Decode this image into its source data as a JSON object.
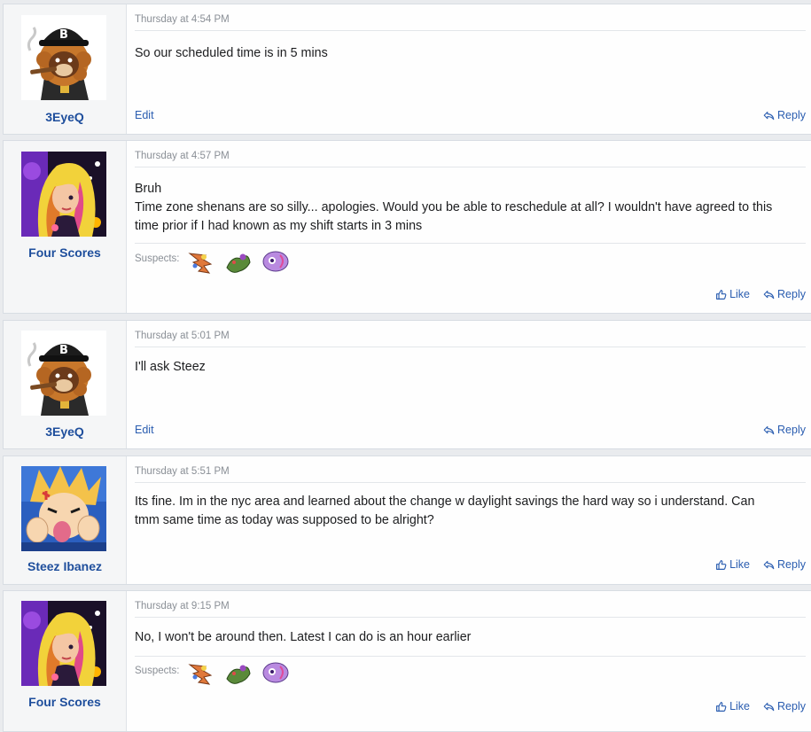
{
  "posts": [
    {
      "username": "3EyeQ",
      "date": "Thursday at 4:54 PM",
      "lines": [
        "So our scheduled time is in 5 mins"
      ],
      "edit_label": "Edit",
      "reply_label": "Reply"
    },
    {
      "username": "Four Scores",
      "date": "Thursday at 4:57 PM",
      "lines": [
        "Bruh",
        "Time zone shenans are so silly... apologies. Would you be able to reschedule at all? I wouldn't have agreed to this",
        "time prior if I had known as my shift starts in 3 mins"
      ],
      "suspects_label": "Suspects:",
      "like_label": "Like",
      "reply_label": "Reply"
    },
    {
      "username": "3EyeQ",
      "date": "Thursday at 5:01 PM",
      "lines": [
        "I'll ask Steez"
      ],
      "edit_label": "Edit",
      "reply_label": "Reply"
    },
    {
      "username": "Steez Ibanez",
      "date": "Thursday at 5:51 PM",
      "lines": [
        "Its fine. Im in the nyc area and learned about the change w daylight savings the hard way so i understand. Can",
        "tmm same time as today was supposed to be alright?"
      ],
      "like_label": "Like",
      "reply_label": "Reply"
    },
    {
      "username": "Four Scores",
      "date": "Thursday at 9:15 PM",
      "lines": [
        "No, I won't be around then. Latest I can do is an hour earlier"
      ],
      "suspects_label": "Suspects:",
      "like_label": "Like",
      "reply_label": "Reply"
    }
  ],
  "icons": {
    "like": "thumbs-up-icon",
    "reply": "reply-arrow-icon"
  }
}
